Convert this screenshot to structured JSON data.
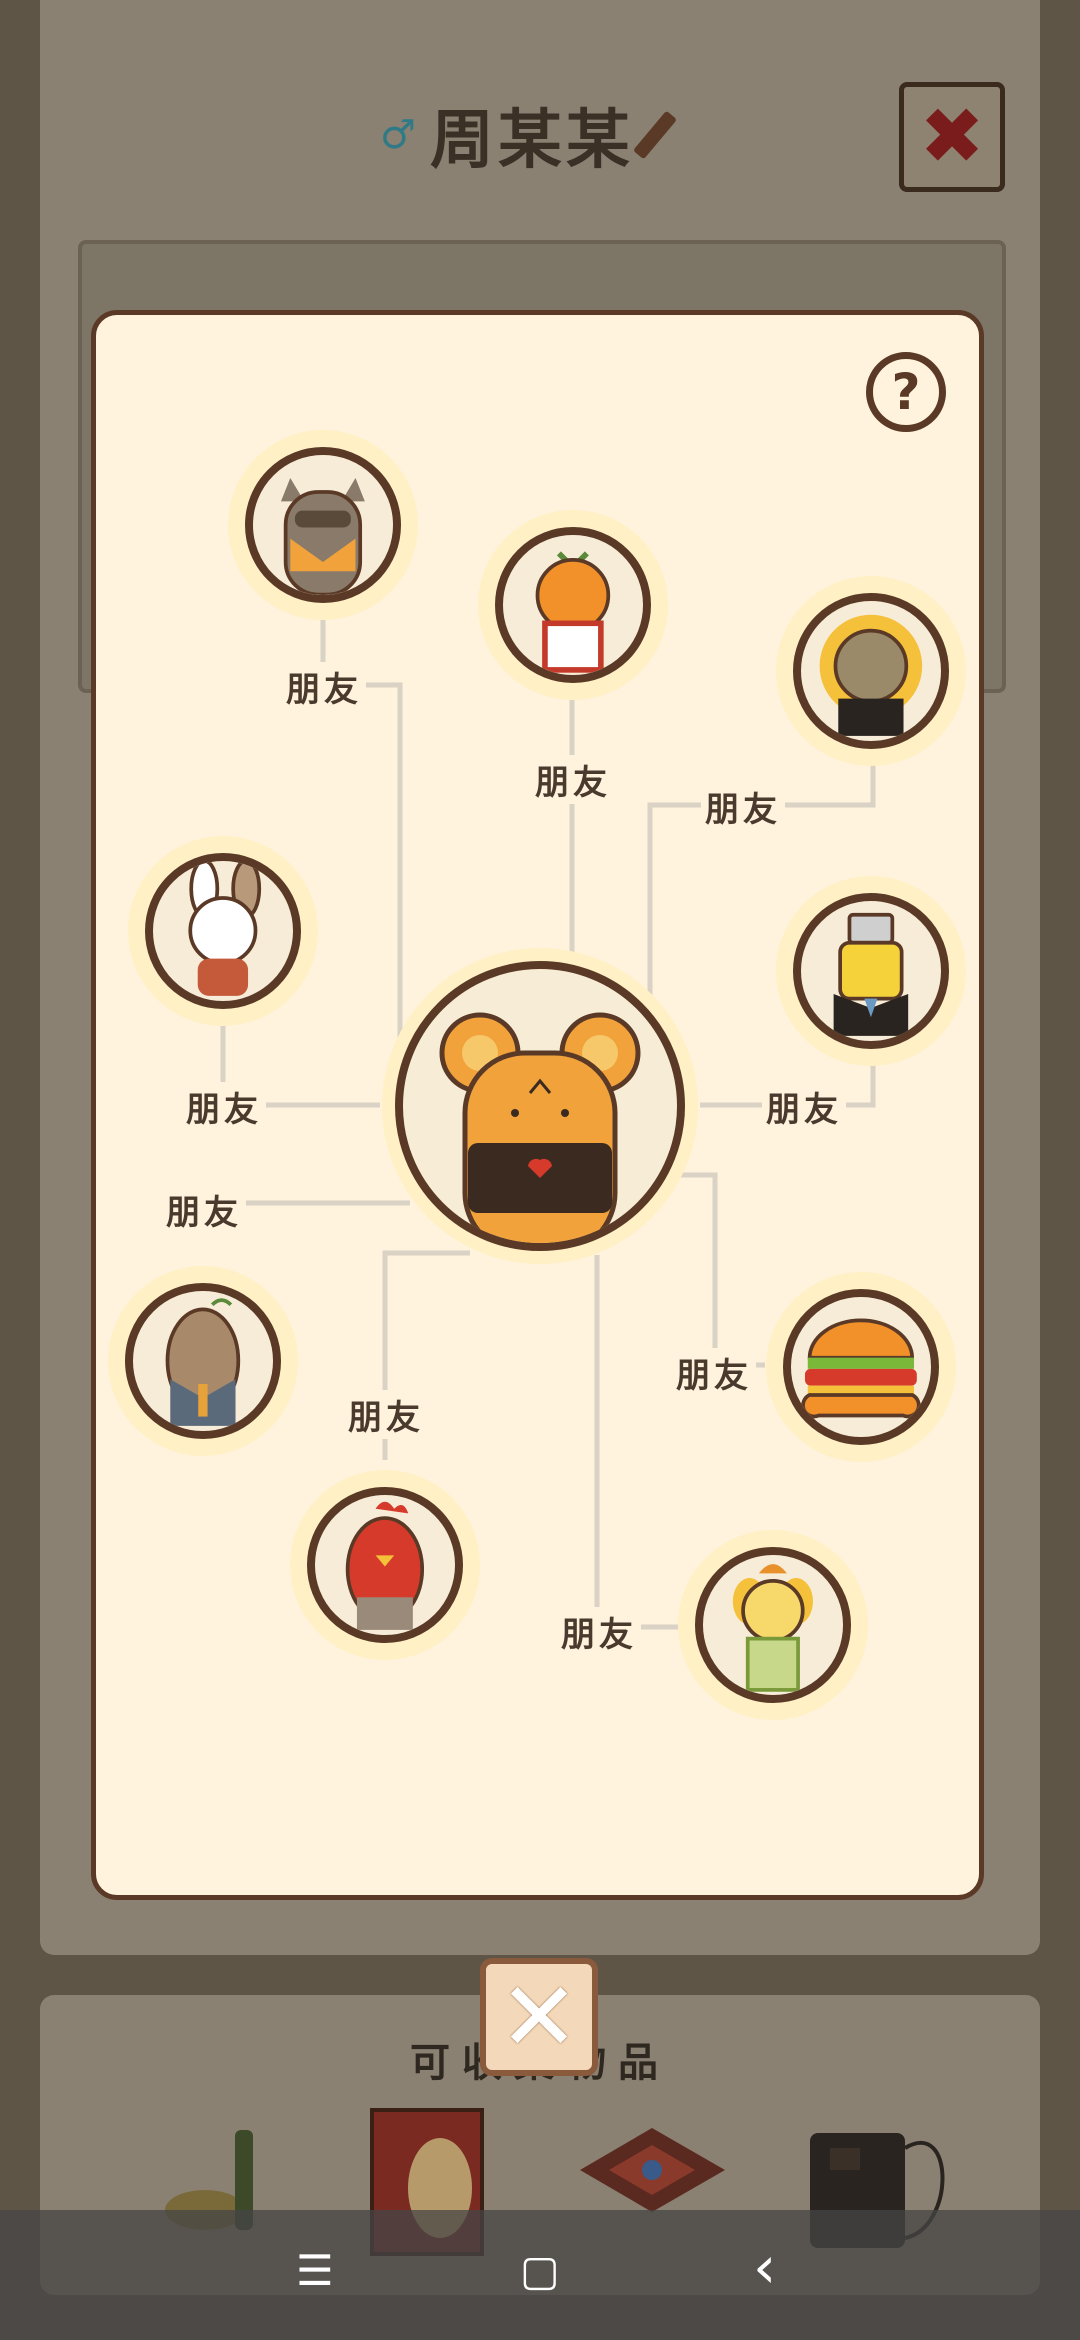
{
  "background": {
    "title_name": "周某某",
    "gender_icon": "male-icon",
    "edit_icon": "pencil-icon",
    "close_symbol": "✖",
    "items_title": "可收集物品"
  },
  "popup": {
    "help_symbol": "?",
    "center": {
      "name": "bear-character"
    },
    "relation_label": "朋友",
    "friends": [
      {
        "id": "raccoon",
        "label": "朋友"
      },
      {
        "id": "orange",
        "label": "朋友"
      },
      {
        "id": "sunflower",
        "label": "朋友"
      },
      {
        "id": "rabbit",
        "label": "朋友"
      },
      {
        "id": "robot-suit",
        "label": "朋友"
      },
      {
        "id": "potato-suit",
        "label": "朋友"
      },
      {
        "id": "burger",
        "label": "朋友"
      },
      {
        "id": "rooster",
        "label": "朋友"
      },
      {
        "id": "pudding",
        "label": "朋友"
      }
    ],
    "close_symbol": "✕"
  },
  "navbar": {
    "menu_symbol": "☰",
    "home_symbol": "▢",
    "back_symbol": "‹"
  },
  "colors": {
    "popup_bg": "#fff3de",
    "border_brown": "#5a3a26",
    "node_glow": "#fff0c5",
    "line_gray": "#d9d2c5"
  }
}
